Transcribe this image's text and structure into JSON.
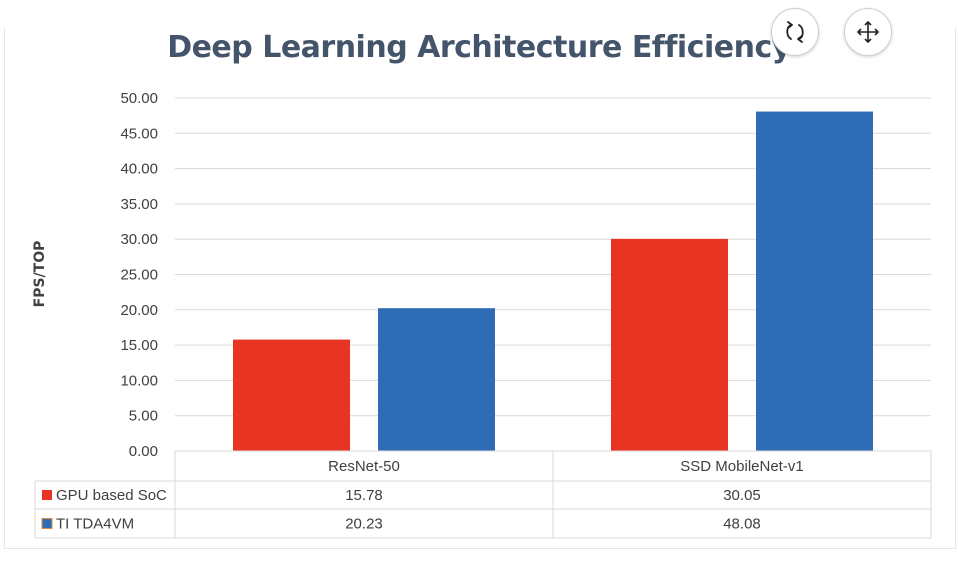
{
  "chart_data": {
    "type": "bar",
    "title": "Deep Learning Architecture Efficiency",
    "ylabel": "FPS/TOP",
    "xlabel": "",
    "categories": [
      "ResNet-50",
      "SSD MobileNet-v1"
    ],
    "series": [
      {
        "name": "GPU based SoC",
        "values": [
          15.78,
          30.05
        ],
        "color": "#e83423"
      },
      {
        "name": "TI TDA4VM",
        "values": [
          20.23,
          48.08
        ],
        "color": "#2f6cb6"
      }
    ],
    "ylim": [
      0,
      50
    ],
    "yticks": [
      "0.00",
      "5.00",
      "10.00",
      "15.00",
      "20.00",
      "25.00",
      "30.00",
      "35.00",
      "40.00",
      "45.00",
      "50.00"
    ],
    "table_values": [
      [
        "15.78",
        "30.05"
      ],
      [
        "20.23",
        "48.08"
      ]
    ],
    "grid": true,
    "legend": "data table"
  },
  "controls": {
    "refresh_icon": "rotate-icon",
    "move_icon": "move-icon"
  }
}
